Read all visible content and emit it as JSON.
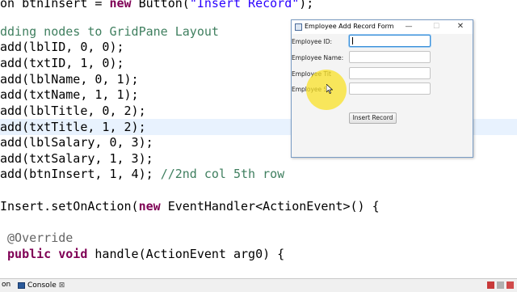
{
  "editor": {
    "lines": [
      {
        "pre": "",
        "plain": "on btnInsert = ",
        "kw": "new",
        "rest": " Button(",
        "str": "\"Insert Record\"",
        "tail": ");"
      },
      {
        "text": ""
      },
      {
        "comment": "dding nodes to GridPane Layout"
      },
      {
        "text": "add(lblID, 0, 0);"
      },
      {
        "text": "add(txtID, 1, 0);"
      },
      {
        "text": "add(lblName, 0, 1);"
      },
      {
        "text": "add(txtName, 1, 1);"
      },
      {
        "text": "add(lblTitle, 0, 2);"
      },
      {
        "text": "add(txtTitle, 1, 2);"
      },
      {
        "text": "add(lblSalary, 0, 3);"
      },
      {
        "text": "add(txtSalary, 1, 3);"
      },
      {
        "text": "add(btnInsert, 1, 4); ",
        "comment": "//2nd col 5th row"
      },
      {
        "text": ""
      },
      {
        "text": "Insert.setOnAction(",
        "kw": "new",
        "rest": " EventHandler<ActionEvent>() {"
      },
      {
        "text": ""
      },
      {
        "annotation": " @Override"
      },
      {
        "kw1": " public",
        "kw2": "void",
        "rest": "handle(ActionEvent arg0) {"
      }
    ]
  },
  "status_bar": {
    "left_text": "on",
    "console_tab_label": "Console",
    "console_tab_close": "⊠"
  },
  "dialog": {
    "title": "Employee Add Record Form",
    "min_glyph": "—",
    "max_glyph": "☐",
    "close_glyph": "✕",
    "labels": {
      "id": "Employee ID:",
      "name": "Employee Name:",
      "title": "Employee Tit",
      "salary": "Employee S     :"
    },
    "fields": {
      "id_value": "",
      "name_value": "",
      "title_value": "",
      "salary_value": ""
    },
    "insert_button_label": "Insert Record"
  },
  "colors": {
    "keyword": "#7f0055",
    "string": "#2a00ff",
    "comment": "#3f7f5f",
    "annotation": "#646464",
    "highlight_line": "#e8f2fe",
    "focus_border": "#3a8fd8",
    "cursor_highlight": "#fae128"
  }
}
